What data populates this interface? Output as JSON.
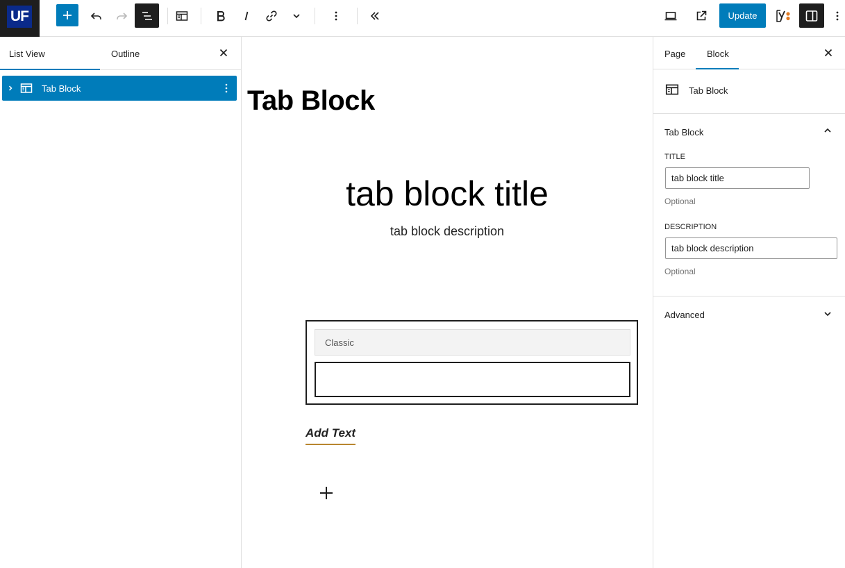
{
  "toolbar": {
    "logo_text": "UF",
    "update_label": "Update"
  },
  "list_view": {
    "tabs": [
      {
        "label": "List View"
      },
      {
        "label": "Outline"
      }
    ],
    "items": [
      {
        "label": "Tab Block"
      }
    ]
  },
  "canvas": {
    "page_title": "Tab Block",
    "block_title": "tab block title",
    "block_description": "tab block description",
    "tabs": [
      {
        "label": "Classic"
      }
    ],
    "add_text_label": "Add Text"
  },
  "settings": {
    "tabs": [
      {
        "label": "Page"
      },
      {
        "label": "Block"
      }
    ],
    "block_card_name": "Tab Block",
    "panel_title": "Tab Block",
    "title_label": "TITLE",
    "title_value": "tab block title",
    "title_help": "Optional",
    "description_label": "DESCRIPTION",
    "description_value": "tab block description",
    "description_help": "Optional",
    "advanced_label": "Advanced"
  },
  "colors": {
    "accent": "#007cba",
    "dark": "#1e1e1e",
    "underline": "#b8862f"
  }
}
